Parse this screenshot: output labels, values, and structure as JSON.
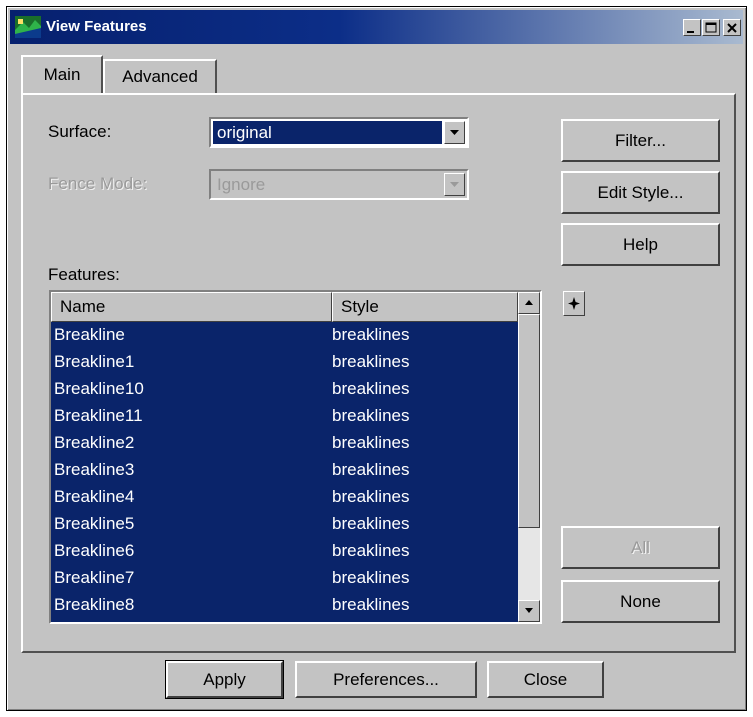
{
  "window": {
    "title": "View Features"
  },
  "tabs": [
    {
      "label": "Main",
      "active": true
    },
    {
      "label": "Advanced",
      "active": false
    }
  ],
  "form": {
    "surface_label": "Surface:",
    "surface_value": "original",
    "fence_label": "Fence Mode:",
    "fence_value": "Ignore"
  },
  "side_buttons": {
    "filter": "Filter...",
    "edit_style": "Edit Style...",
    "help": "Help",
    "all": "All",
    "none": "None"
  },
  "features": {
    "label": "Features:",
    "columns": [
      "Name",
      "Style"
    ],
    "rows": [
      {
        "name": "Breakline",
        "style": "breaklines"
      },
      {
        "name": "Breakline1",
        "style": "breaklines"
      },
      {
        "name": "Breakline10",
        "style": "breaklines"
      },
      {
        "name": "Breakline11",
        "style": "breaklines"
      },
      {
        "name": "Breakline2",
        "style": "breaklines"
      },
      {
        "name": "Breakline3",
        "style": "breaklines"
      },
      {
        "name": "Breakline4",
        "style": "breaklines"
      },
      {
        "name": "Breakline5",
        "style": "breaklines"
      },
      {
        "name": "Breakline6",
        "style": "breaklines"
      },
      {
        "name": "Breakline7",
        "style": "breaklines"
      },
      {
        "name": "Breakline8",
        "style": "breaklines"
      }
    ]
  },
  "footer": {
    "apply": "Apply",
    "preferences": "Preferences...",
    "close": "Close"
  },
  "icons": {
    "app": "view-features-icon",
    "minimize": "minimize-icon",
    "maximize": "maximize-icon",
    "close": "close-icon",
    "dropdown": "chevron-down-icon",
    "scroll_up": "scroll-up-arrow-icon",
    "scroll_down": "scroll-down-arrow-icon",
    "star": "star-icon"
  },
  "colors": {
    "title_bar": "#0c2e88",
    "selection": "#0a246a",
    "face": "#c3c3c3"
  }
}
